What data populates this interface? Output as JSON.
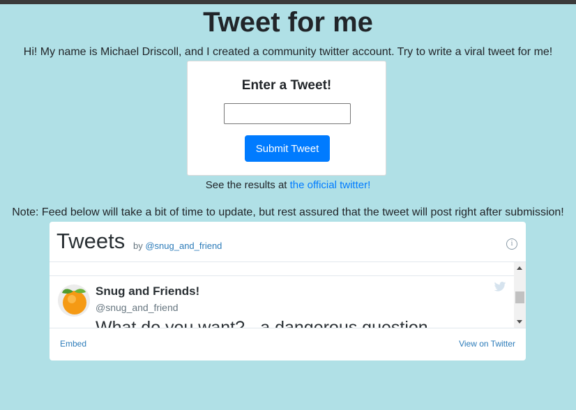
{
  "page": {
    "title": "Tweet for me",
    "intro": "Hi! My name is Michael Driscoll, and I created a community twitter account. Try to write a viral tweet for me!"
  },
  "form": {
    "heading": "Enter a Tweet!",
    "input_value": "",
    "submit_label": "Submit Tweet"
  },
  "results": {
    "prefix": "See the results at ",
    "link_text": "the official twitter!"
  },
  "note": "Note: Feed below will take a bit of time to update, but rest assured that the tweet will post right after submission!",
  "widget": {
    "title": "Tweets",
    "by_prefix": "by ",
    "by_handle": "@snug_and_friend",
    "tweet": {
      "name": "Snug and Friends!",
      "handle": "@snug_and_friend",
      "text": "What do you want? - a dangerous question"
    },
    "footer": {
      "embed_label": "Embed",
      "view_label": "View on Twitter"
    },
    "icons": {
      "info": "info-icon",
      "bird": "twitter-bird-icon",
      "avatar": "orange-avatar"
    },
    "colors": {
      "link": "#2b7bb9",
      "bird": "#d6e3ee"
    }
  },
  "colors": {
    "background": "#b0e0e6",
    "primary": "#007bff"
  }
}
